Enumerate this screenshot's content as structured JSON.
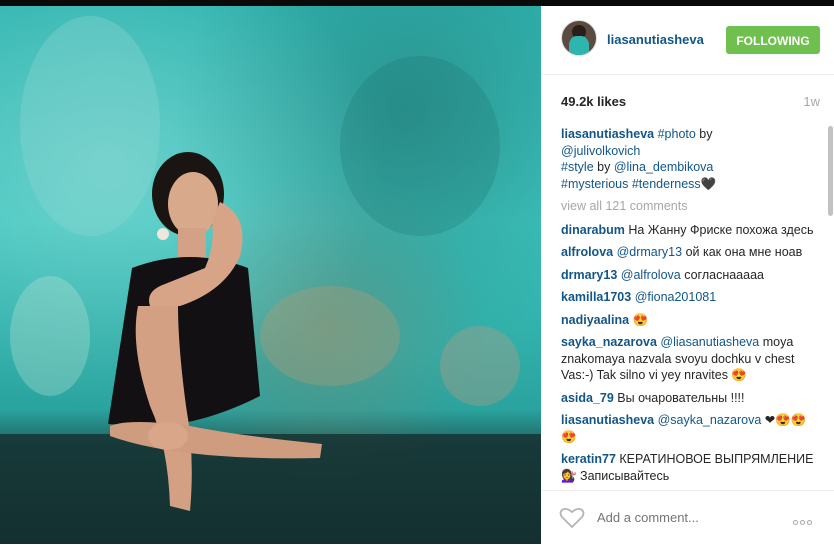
{
  "post": {
    "username": "liasanutiasheva",
    "follow_label": "FOLLOWING",
    "likes": "49.2k likes",
    "age": "1w",
    "caption": {
      "user": "liasanutiasheva",
      "tag_photo": "#photo",
      "by1": " by",
      "mention1": "@julivolkovich",
      "tag_style": "#style",
      "by2": " by ",
      "mention2": "@lina_dembikova",
      "tags_end": "#mysterious #tenderness🖤"
    },
    "view_all": "view all 121 comments",
    "comments": [
      {
        "user": "dinarabum",
        "text": " На Жанну Фриске похожа здесь"
      },
      {
        "user": "alfrolova",
        "mention": "@drmary13",
        "text": " ой как она мне ноав"
      },
      {
        "user": "drmary13",
        "mention": "@alfrolova",
        "text": " согласнааааа"
      },
      {
        "user": "kamilla1703",
        "mention": "@fiona201081",
        "text": ""
      },
      {
        "user": "nadiyaalina",
        "text": " 😍"
      },
      {
        "user": "sayka_nazarova",
        "mention": "@liasanutiasheva",
        "text": " moya znakomaya nazvala svoyu dochku v chest Vas:-) Tak silno vi yey nravites 😍"
      },
      {
        "user": "asida_79",
        "text": " Вы очаровательны !!!!"
      },
      {
        "user": "liasanutiasheva",
        "mention": "@sayka_nazarova",
        "text": " ❤😍😍😍"
      },
      {
        "user": "keratin77",
        "text": " КЕРАТИНОВОЕ ВЫПРЯМЛЕНИЕ💇‍♀️ Записывайтесь"
      }
    ],
    "add_comment_placeholder": "Add a comment..."
  },
  "colors": {
    "link": "#125688",
    "follow_green": "#70c050",
    "muted": "#a5a7aa"
  },
  "icons": [
    "heart-icon",
    "more-options-icon"
  ]
}
